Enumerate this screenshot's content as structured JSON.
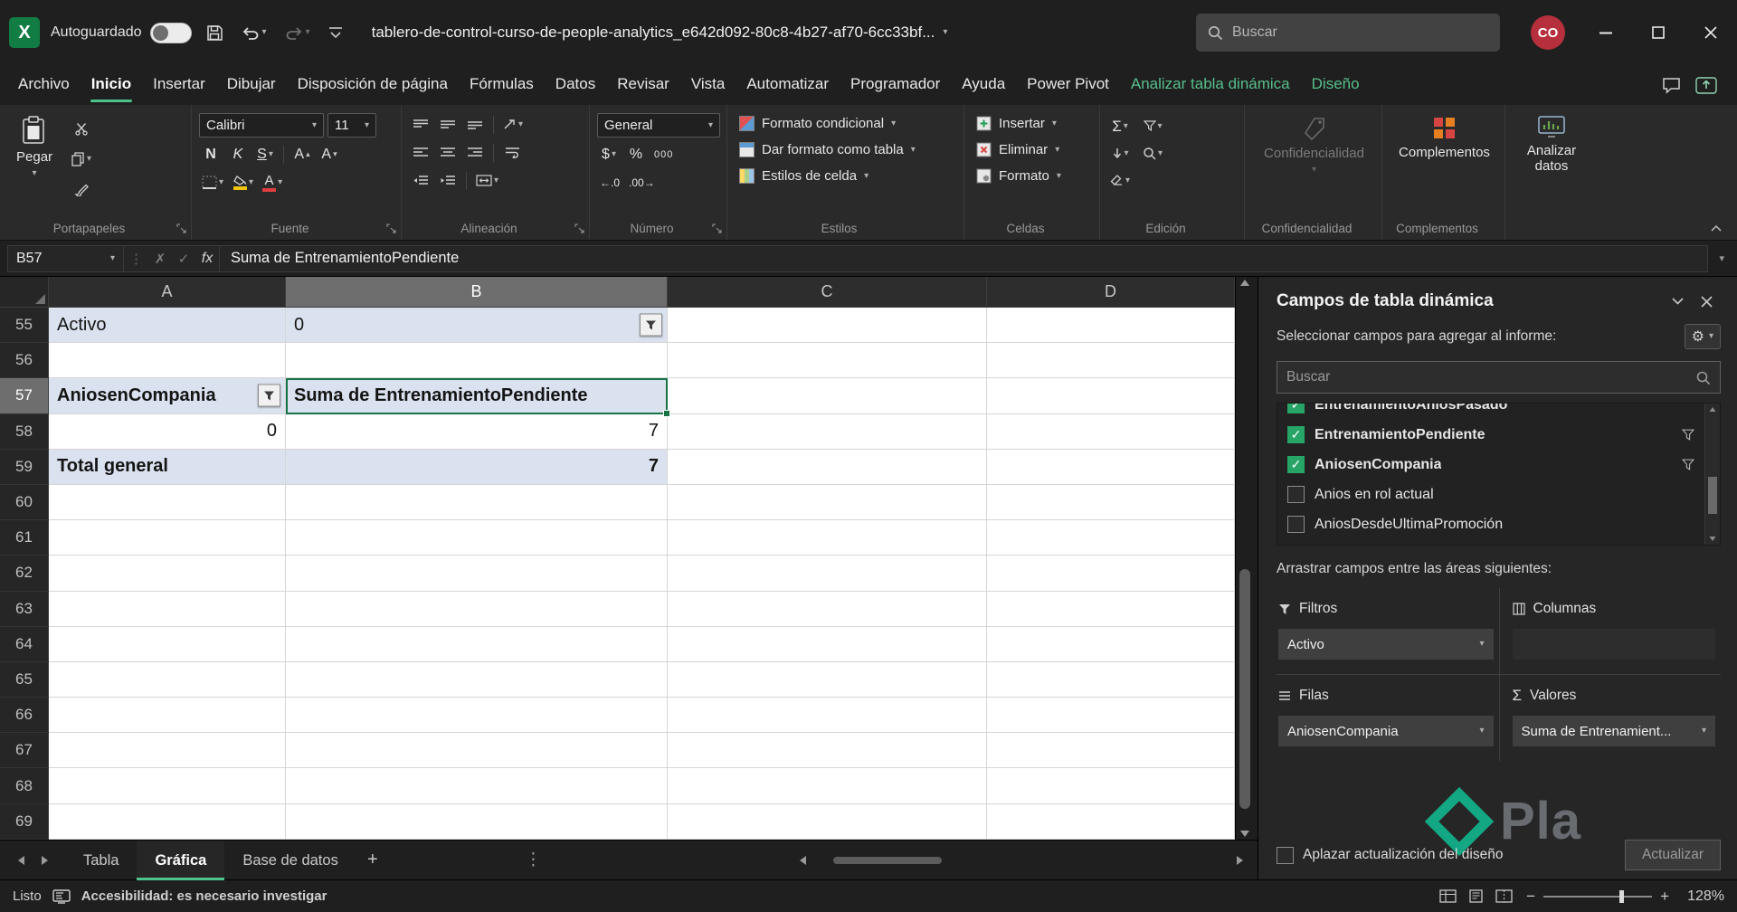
{
  "titlebar": {
    "autosave": "Autoguardado",
    "filename": "tablero-de-control-curso-de-people-analytics_e642d092-80c8-4b27-af70-6cc33bf...",
    "search_placeholder": "Buscar",
    "avatar": "CO"
  },
  "menubar": {
    "tabs": [
      {
        "label": "Archivo"
      },
      {
        "label": "Inicio",
        "active": true
      },
      {
        "label": "Insertar"
      },
      {
        "label": "Dibujar"
      },
      {
        "label": "Disposición de página"
      },
      {
        "label": "Fórmulas"
      },
      {
        "label": "Datos"
      },
      {
        "label": "Revisar"
      },
      {
        "label": "Vista"
      },
      {
        "label": "Automatizar"
      },
      {
        "label": "Programador"
      },
      {
        "label": "Ayuda"
      },
      {
        "label": "Power Pivot"
      },
      {
        "label": "Analizar tabla dinámica",
        "contextual": true
      },
      {
        "label": "Diseño",
        "contextual": true
      }
    ]
  },
  "ribbon": {
    "paste_label": "Pegar",
    "font_name": "Calibri",
    "font_size": "11",
    "number_format": "General",
    "conditional_format": "Formato condicional",
    "format_as_table": "Dar formato como tabla",
    "cell_styles": "Estilos de celda",
    "insert": "Insertar",
    "delete": "Eliminar",
    "format": "Formato",
    "confidentiality": "Confidencialidad",
    "addins": "Complementos",
    "analyze_data": "Analizar datos",
    "group_labels": [
      "Portapapeles",
      "Fuente",
      "Alineación",
      "Número",
      "Estilos",
      "Celdas",
      "Edición",
      "Confidencialidad",
      "Complementos"
    ],
    "glyphs": {
      "bold": "N",
      "italic": "K",
      "underline": "S",
      "font": "A",
      "currency": "$",
      "percent": "%",
      "thousands": "000",
      "sum": "Σ",
      "dec_inc": "←.0",
      "dec_dec": ".00→"
    }
  },
  "formula_bar": {
    "name_box": "B57",
    "fx_label": "fx",
    "content": "Suma de EntrenamientoPendiente"
  },
  "grid": {
    "columns": [
      "A",
      "B",
      "C",
      "D"
    ],
    "selected_cell": "B57",
    "rows": [
      {
        "n": "55",
        "hl": true,
        "cells": [
          {
            "col": "A",
            "text": "Activo"
          },
          {
            "col": "B",
            "text": "0",
            "filter": true
          }
        ]
      },
      {
        "n": "56"
      },
      {
        "n": "57",
        "hl": true,
        "sel": true,
        "cells": [
          {
            "col": "A",
            "text": "AniosenCompania",
            "bold": true,
            "filter": true
          },
          {
            "col": "B",
            "text": "Suma de EntrenamientoPendiente",
            "bold": true,
            "selected": true
          }
        ]
      },
      {
        "n": "58",
        "cells": [
          {
            "col": "A",
            "text": "0",
            "align": "right"
          },
          {
            "col": "B",
            "text": "7",
            "align": "right"
          }
        ]
      },
      {
        "n": "59",
        "hl": true,
        "cells": [
          {
            "col": "A",
            "text": "Total general",
            "bold": true
          },
          {
            "col": "B",
            "text": "7",
            "bold": true,
            "align": "right"
          }
        ]
      },
      {
        "n": "60"
      },
      {
        "n": "61"
      },
      {
        "n": "62"
      },
      {
        "n": "63"
      },
      {
        "n": "64"
      },
      {
        "n": "65"
      },
      {
        "n": "66"
      },
      {
        "n": "67"
      },
      {
        "n": "68"
      },
      {
        "n": "69"
      }
    ]
  },
  "pane": {
    "title": "Campos de tabla dinámica",
    "subtitle": "Seleccionar campos para agregar al informe:",
    "search_placeholder": "Buscar",
    "fields": [
      {
        "label": "EntrenamientoAniosPasado",
        "checked": true,
        "bold": true,
        "clipped": true
      },
      {
        "label": "EntrenamientoPendiente",
        "checked": true,
        "bold": true,
        "filter": true
      },
      {
        "label": "AniosenCompania",
        "checked": true,
        "bold": true,
        "filter": true
      },
      {
        "label": "Anios en rol actual",
        "checked": false
      },
      {
        "label": "AniosDesdeUltimaPromoción",
        "checked": false
      }
    ],
    "drag_hint": "Arrastrar campos entre las áreas siguientes:",
    "areas": {
      "filters": {
        "label": "Filtros",
        "value": "Activo"
      },
      "columns": {
        "label": "Columnas",
        "value": ""
      },
      "rows": {
        "label": "Filas",
        "value": "AniosenCompania"
      },
      "values": {
        "label": "Valores",
        "value": "Suma de Entrenamient..."
      }
    },
    "defer_label": "Aplazar actualización del diseño",
    "update_button": "Actualizar"
  },
  "sheet_tabs": {
    "tabs": [
      {
        "label": "Tabla"
      },
      {
        "label": "Gráfica",
        "active": true
      },
      {
        "label": "Base de datos"
      }
    ]
  },
  "status_bar": {
    "ready": "Listo",
    "accessibility": "Accesibilidad: es necesario investigar",
    "zoom": "128%"
  },
  "watermark": {
    "text": "Pla"
  }
}
